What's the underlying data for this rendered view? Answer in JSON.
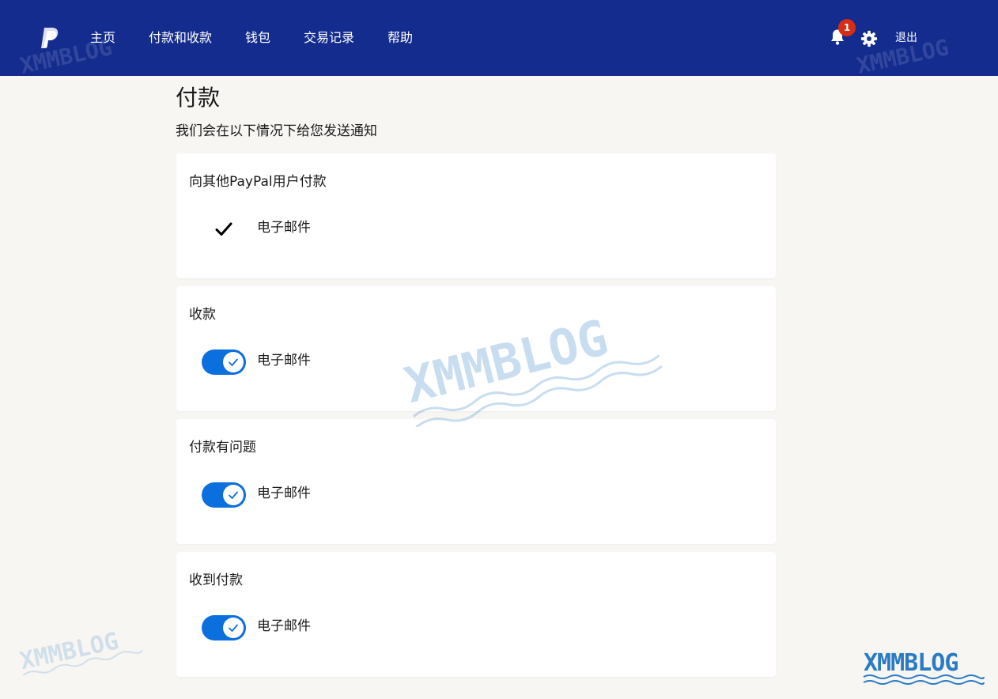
{
  "header": {
    "nav": [
      "主页",
      "付款和收款",
      "钱包",
      "交易记录",
      "帮助"
    ],
    "notification_count": "1",
    "logout_label": "退出"
  },
  "page": {
    "title": "付款",
    "subtitle": "我们会在以下情况下给您发送通知"
  },
  "cards": [
    {
      "title": "向其他PayPal用户付款",
      "option": "电子邮件",
      "control": "checkmark",
      "enabled": true
    },
    {
      "title": "收款",
      "option": "电子邮件",
      "control": "toggle",
      "enabled": true
    },
    {
      "title": "付款有问题",
      "option": "电子邮件",
      "control": "toggle",
      "enabled": true
    },
    {
      "title": "收到付款",
      "option": "电子邮件",
      "control": "toggle",
      "enabled": true
    }
  ],
  "watermark": "XMMBLOG",
  "icons": [
    "paypal-logo-icon",
    "bell-icon",
    "gear-icon",
    "checkmark-icon",
    "toggle-check-icon"
  ],
  "colors": {
    "header_bg": "#142c8e",
    "page_bg": "#f7f6f3",
    "toggle_on": "#0b6fde",
    "badge": "#d72c16"
  }
}
